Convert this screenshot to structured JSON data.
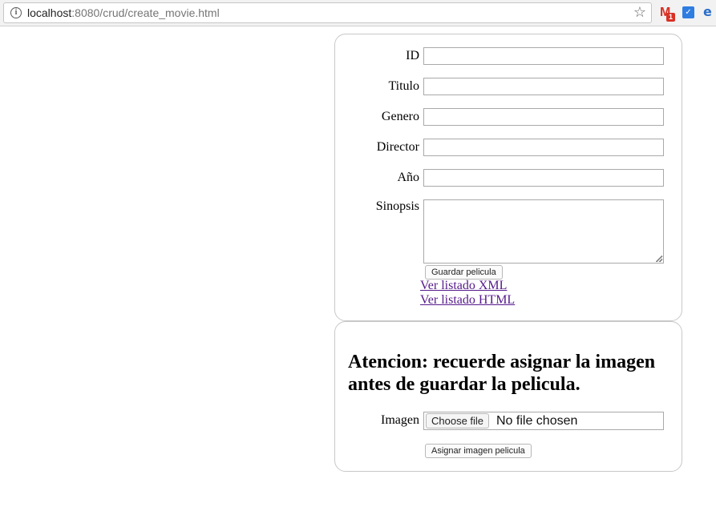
{
  "browser": {
    "url_host": "localhost",
    "url_rest": ":8080/crud/create_movie.html",
    "gmail_badge": "1"
  },
  "form": {
    "fields": [
      {
        "label": "ID",
        "value": ""
      },
      {
        "label": "Titulo",
        "value": ""
      },
      {
        "label": "Genero",
        "value": ""
      },
      {
        "label": "Director",
        "value": ""
      },
      {
        "label": "Año",
        "value": ""
      }
    ],
    "synopsis_label": "Sinopsis",
    "synopsis_value": "",
    "save_button": "Guardar pelicula",
    "links": {
      "xml": "Ver listado XML",
      "html": "Ver listado HTML"
    }
  },
  "image_section": {
    "notice": "Atencion: recuerde asignar la imagen antes de guardar la pelicula.",
    "label": "Imagen",
    "choose_button": "Choose file",
    "file_status": "No file chosen",
    "assign_button": "Asignar imagen pelicula"
  }
}
